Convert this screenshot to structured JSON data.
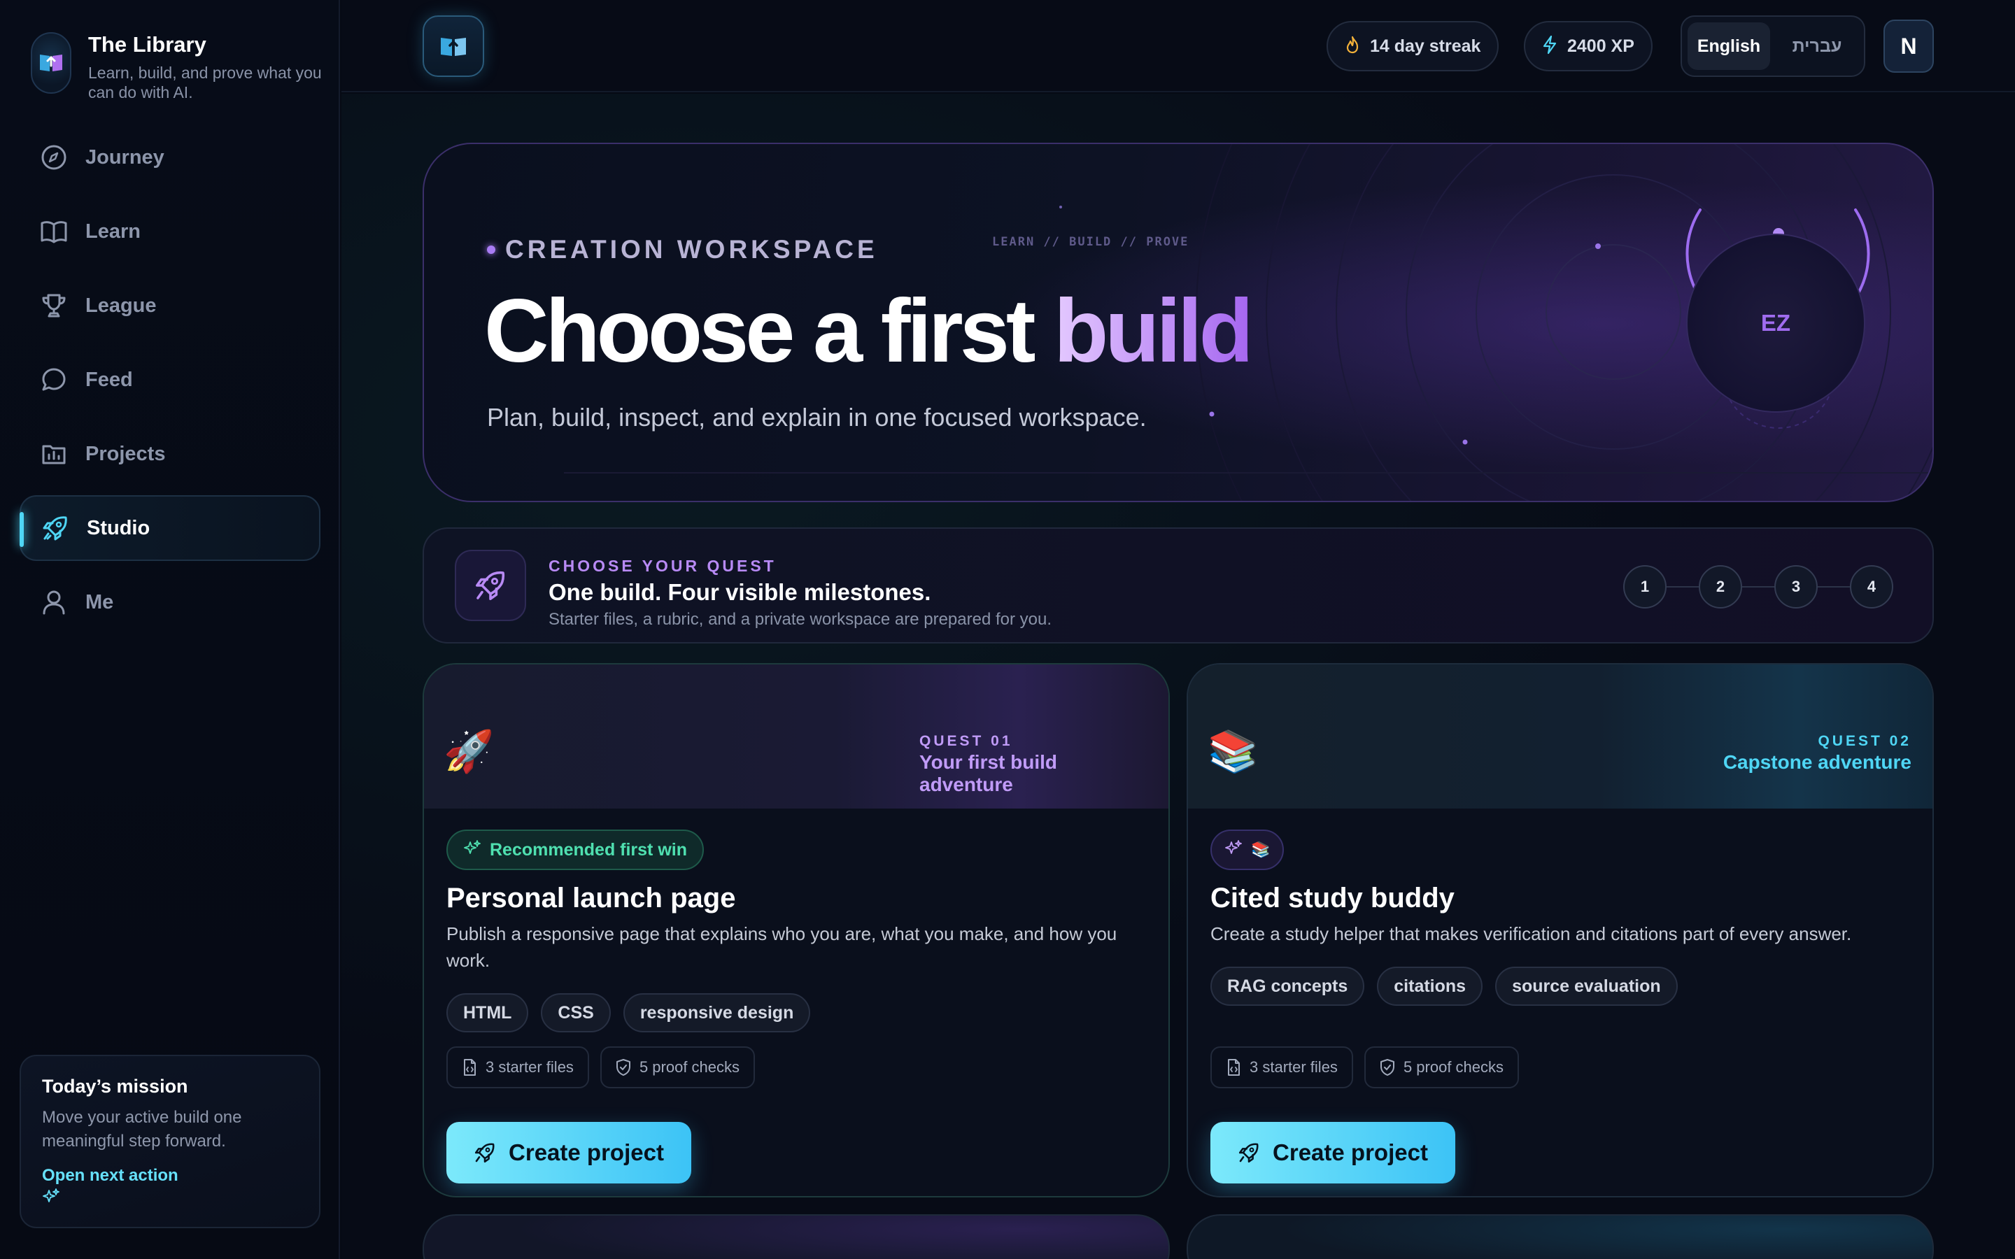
{
  "brand": {
    "title": "The Library",
    "subtitle": "Learn, build, and prove what you can do with AI."
  },
  "sidebar": {
    "items": [
      {
        "label": "Journey",
        "icon": "compass-icon",
        "active": false
      },
      {
        "label": "Learn",
        "icon": "book-icon",
        "active": false
      },
      {
        "label": "League",
        "icon": "trophy-icon",
        "active": false
      },
      {
        "label": "Feed",
        "icon": "chat-bubble-icon",
        "active": false
      },
      {
        "label": "Projects",
        "icon": "folder-chart-icon",
        "active": false
      },
      {
        "label": "Studio",
        "icon": "rocket-icon",
        "active": true
      },
      {
        "label": "Me",
        "icon": "user-icon",
        "active": false
      }
    ],
    "mission": {
      "title": "Today’s mission",
      "text": "Move your active build one meaningful step forward.",
      "link": "Open next action"
    }
  },
  "topbar": {
    "streak": "14 day streak",
    "xp": "2400 XP",
    "languages": [
      "English",
      "עברית"
    ],
    "active_language": "English",
    "avatar_initial": "N"
  },
  "hero": {
    "eyebrow": "CREATION WORKSPACE",
    "tag": "LEARN // BUILD // PROVE",
    "title_main": "Choose a first ",
    "title_accent": "build",
    "subtitle": "Plan, build, inspect, and explain in one focused workspace.",
    "orb_label": "EZ"
  },
  "quest_strip": {
    "eyebrow": "CHOOSE YOUR QUEST",
    "title": "One build. Four visible milestones.",
    "subtitle": "Starter files, a rubric, and a private workspace are prepared for you.",
    "steps": [
      "1",
      "2",
      "3",
      "4"
    ]
  },
  "cards": [
    {
      "emoji": "🚀",
      "quest_no": "QUEST 01",
      "quest_name": "Your first build adventure",
      "badge": "Recommended first win",
      "title": "Personal launch page",
      "description": "Publish a responsive page that explains who you are, what you make, and how you work.",
      "tags": [
        "HTML",
        "CSS",
        "responsive design"
      ],
      "starter_files": "3 starter files",
      "proof_checks": "5 proof checks",
      "cta": "Create project"
    },
    {
      "emoji": "📚",
      "quest_no": "QUEST 02",
      "quest_name": "Capstone adventure",
      "badge_emoji": "📚",
      "title": "Cited study buddy",
      "description": "Create a study helper that makes verification and citations part of every answer.",
      "tags": [
        "RAG concepts",
        "citations",
        "source evaluation"
      ],
      "starter_files": "3 starter files",
      "proof_checks": "5 proof checks",
      "cta": "Create project"
    }
  ],
  "colors": {
    "accent_cyan": "#4fd6f5",
    "accent_purple": "#a566f0",
    "accent_green": "#4fe0b0",
    "background": "#060a14"
  }
}
